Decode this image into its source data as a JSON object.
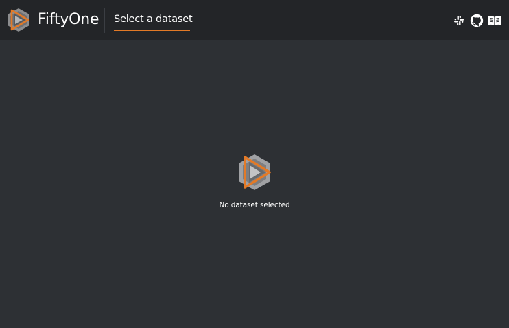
{
  "header": {
    "brand_name": "FiftyOne",
    "dataset_selector_label": "Select a dataset",
    "icons": [
      "slack-icon",
      "github-icon",
      "docs-book-icon"
    ]
  },
  "main": {
    "empty_state_text": "No dataset selected"
  },
  "colors": {
    "accent": "#e37a27",
    "header_bg": "#232528",
    "page_bg": "#2d3034",
    "logo_gray": "#9a9a9c"
  }
}
